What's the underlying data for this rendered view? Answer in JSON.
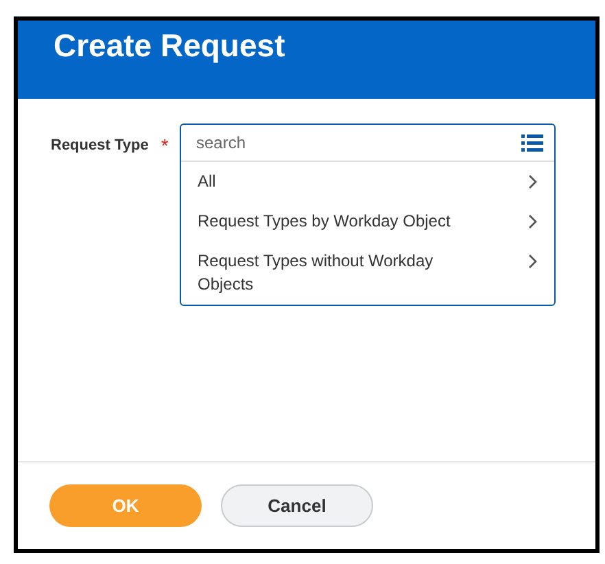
{
  "dialog": {
    "title": "Create Request"
  },
  "field": {
    "label": "Request Type",
    "required_mark": "*",
    "placeholder": "search"
  },
  "options": [
    {
      "label": "All"
    },
    {
      "label": "Request Types by Workday Object"
    },
    {
      "label": "Request Types without Workday Objects"
    }
  ],
  "buttons": [
    {
      "label": "OK",
      "kind": "primary"
    },
    {
      "label": "Cancel",
      "kind": "secondary"
    }
  ]
}
